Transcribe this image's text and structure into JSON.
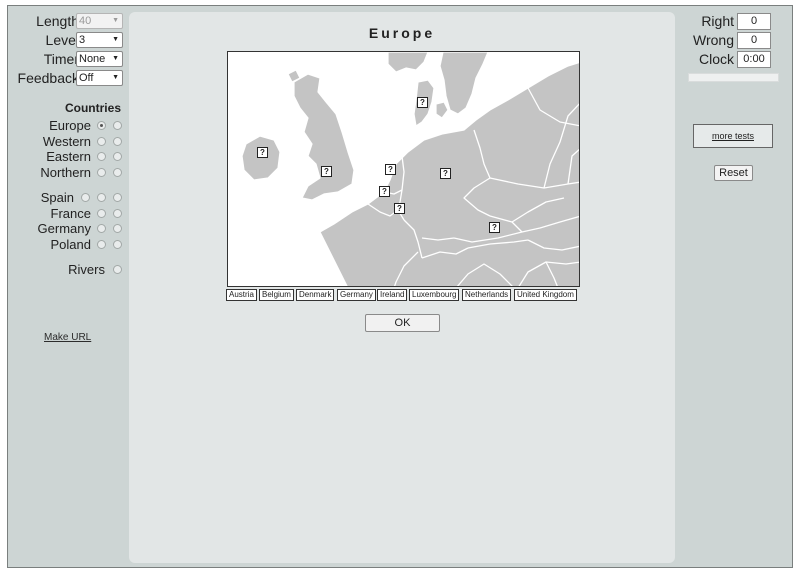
{
  "left_panel": {
    "controls": [
      {
        "id": "length",
        "label": "Length",
        "value": "40",
        "disabled": true
      },
      {
        "id": "level",
        "label": "Level",
        "value": "3",
        "disabled": false
      },
      {
        "id": "timer",
        "label": "Timer",
        "value": "None",
        "disabled": false
      },
      {
        "id": "feedback",
        "label": "Feedback",
        "value": "Off",
        "disabled": false
      }
    ],
    "countries_title": "Countries",
    "region_options": [
      {
        "label": "Europe",
        "radios": [
          true,
          false
        ]
      },
      {
        "label": "Western",
        "radios": [
          false,
          false
        ]
      },
      {
        "label": "Eastern",
        "radios": [
          false,
          false
        ]
      },
      {
        "label": "Northern",
        "radios": [
          false,
          false
        ]
      }
    ],
    "country_options": [
      {
        "label": "Spain",
        "radios": [
          false,
          false,
          false
        ]
      },
      {
        "label": "France",
        "radios": [
          false,
          false
        ]
      },
      {
        "label": "Germany",
        "radios": [
          false,
          false
        ]
      },
      {
        "label": "Poland",
        "radios": [
          false,
          false
        ]
      }
    ],
    "rivers_label": "Rivers",
    "make_url_label": "Make URL"
  },
  "main": {
    "title": "Europe",
    "question_mark": "?",
    "answer_tags": [
      "Austria",
      "Belgium",
      "Denmark",
      "Germany",
      "Ireland",
      "Luxembourg",
      "Netherlands",
      "United Kingdom"
    ],
    "ok_label": "OK",
    "colors": {
      "land": "#c4c4c4",
      "sea": "#ffffff",
      "border": "#ffffff"
    }
  },
  "right_panel": {
    "right_label": "Right",
    "right_value": "0",
    "wrong_label": "Wrong",
    "wrong_value": "0",
    "clock_label": "Clock",
    "clock_value": "0:00",
    "progress_fraction": 0,
    "more_tests_label": "more tests",
    "reset_label": "Reset"
  }
}
